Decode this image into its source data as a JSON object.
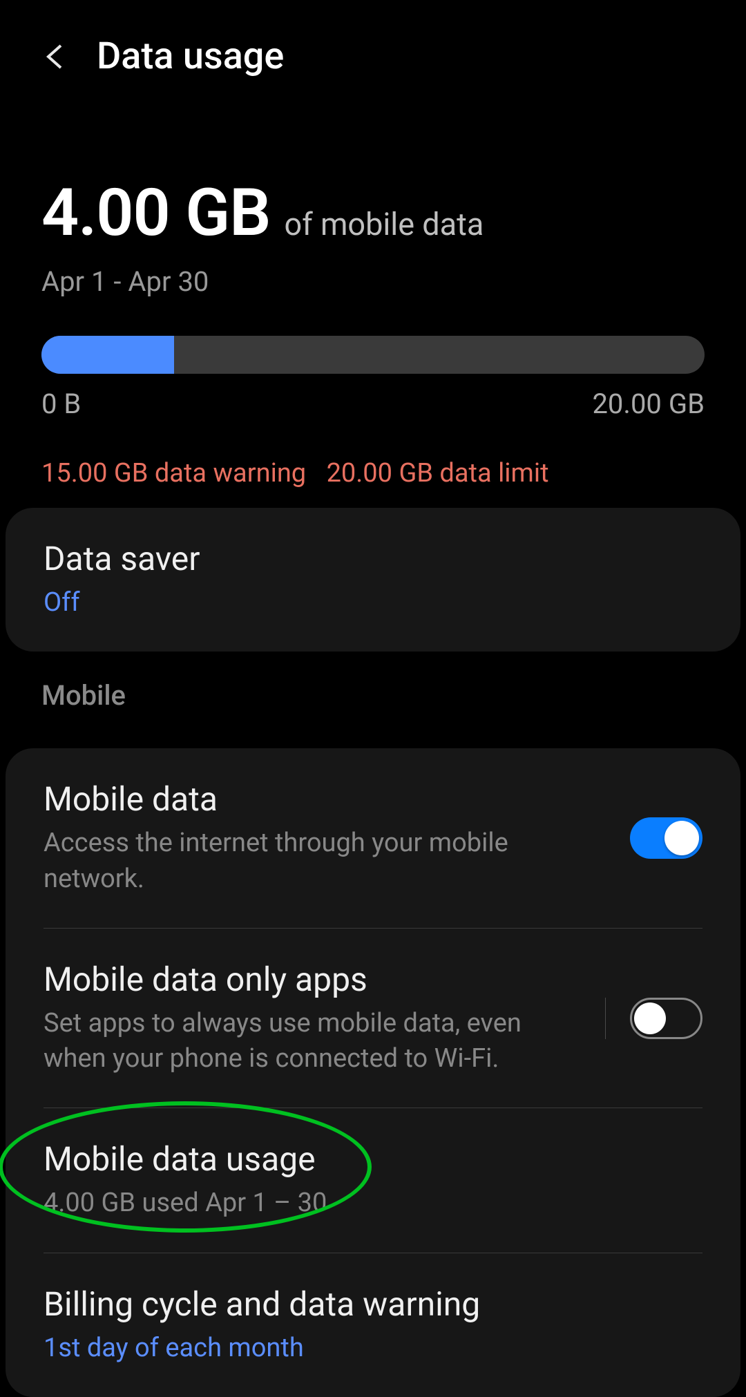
{
  "header": {
    "title": "Data usage"
  },
  "summary": {
    "amount": "4.00 GB",
    "suffix": "of mobile data",
    "date_range": "Apr 1 - Apr 30",
    "progress_min": "0 B",
    "progress_max": "20.00 GB",
    "warning_text": "15.00 GB data warning",
    "limit_text": "20.00 GB data limit"
  },
  "data_saver": {
    "title": "Data saver",
    "status": "Off"
  },
  "section_mobile": "Mobile",
  "mobile_data": {
    "title": "Mobile data",
    "subtitle": "Access the internet through your mobile network."
  },
  "mobile_only_apps": {
    "title": "Mobile data only apps",
    "subtitle": "Set apps to always use mobile data, even when your phone is connected to Wi-Fi."
  },
  "mobile_usage": {
    "title": "Mobile data usage",
    "subtitle": "4.00 GB used Apr 1 – 30"
  },
  "billing": {
    "title": "Billing cycle and data warning",
    "subtitle": "1st day of each month"
  }
}
